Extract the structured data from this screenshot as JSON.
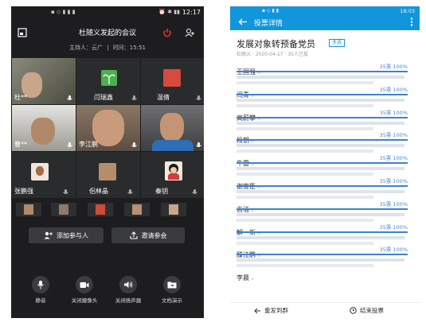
{
  "left": {
    "status_time": "12:17",
    "title": "杜随义发起的会议",
    "host_label": "主持人：云广",
    "time_label": "时间：15:51",
    "tiles": [
      {
        "name": "杜**"
      },
      {
        "name": "闫瑞鑫"
      },
      {
        "name": "温倩"
      },
      {
        "name": "曹**"
      },
      {
        "name": "李江鹏"
      },
      {
        "name": ""
      },
      {
        "name": "张鹏强"
      },
      {
        "name": "佀林晶"
      },
      {
        "name": "秦钥"
      }
    ],
    "add_participant": "添加参与人",
    "invite": "邀请参会",
    "controls": [
      "静音",
      "关闭摄像头",
      "关闭扬声器",
      "文档演示"
    ]
  },
  "right": {
    "status_time": "18:03",
    "header_title": "投票详情",
    "vote_title": "发展对象转预备党员",
    "vote_tag": "多选",
    "vote_meta": "杜随义 · 2020-04-17 · 35人已投",
    "candidates": [
      {
        "name": "王国强",
        "votes": "35票 100%"
      },
      {
        "name": "闫青",
        "votes": "35票 100%"
      },
      {
        "name": "高蔚攀",
        "votes": "35票 100%"
      },
      {
        "name": "段朝",
        "votes": "35票 100%"
      },
      {
        "name": "牛雷",
        "votes": "35票 100%"
      },
      {
        "name": "谢宜臣",
        "votes": "35票 100%"
      },
      {
        "name": "吉洁",
        "votes": "35票 100%"
      },
      {
        "name": "解一新",
        "votes": "35票 100%"
      },
      {
        "name": "滕江鹏",
        "votes": "35票 100%"
      },
      {
        "name": "李晨",
        "votes": ""
      }
    ],
    "resend": "重发到群",
    "end_vote": "结束投票"
  },
  "colors": {
    "accent": "#1296db",
    "bar": "#3b82d6",
    "dark_bg": "#1d1d1f",
    "end_red": "#e53935"
  }
}
